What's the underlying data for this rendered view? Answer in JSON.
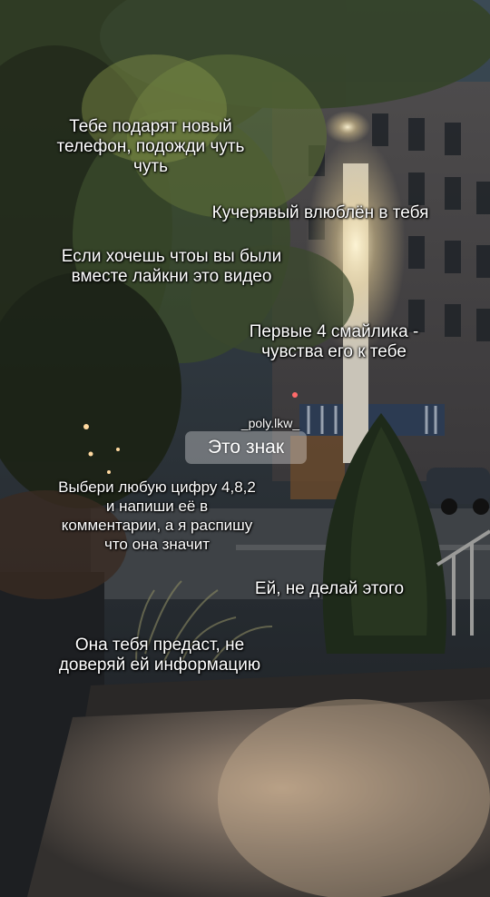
{
  "captions": {
    "phone_gift": "Тебе подарят новый\nтелефон, подожди чуть\nчуть",
    "curly_in_love": "Кучерявый влюблён в тебя",
    "like_video": "Если хочешь чтоы вы были\nвместе лайкни это видео",
    "first_emojis": "Первые 4 смайлика -\nчувства его к тебе",
    "pick_number": "Выбери любую цифру 4,8,2\nи напиши её в\nкомментарии, а я распишу\nчто она значит",
    "dont_do_this": "Ей, не делай этого",
    "betrayal": "Она тебя предаст, не\nдоверяй ей информацию"
  },
  "username": "_poly.lkw_",
  "sign_label": "Это знак",
  "colors": {
    "caption_text": "#ffffff",
    "sign_bg": "rgba(255,255,255,0.32)"
  }
}
